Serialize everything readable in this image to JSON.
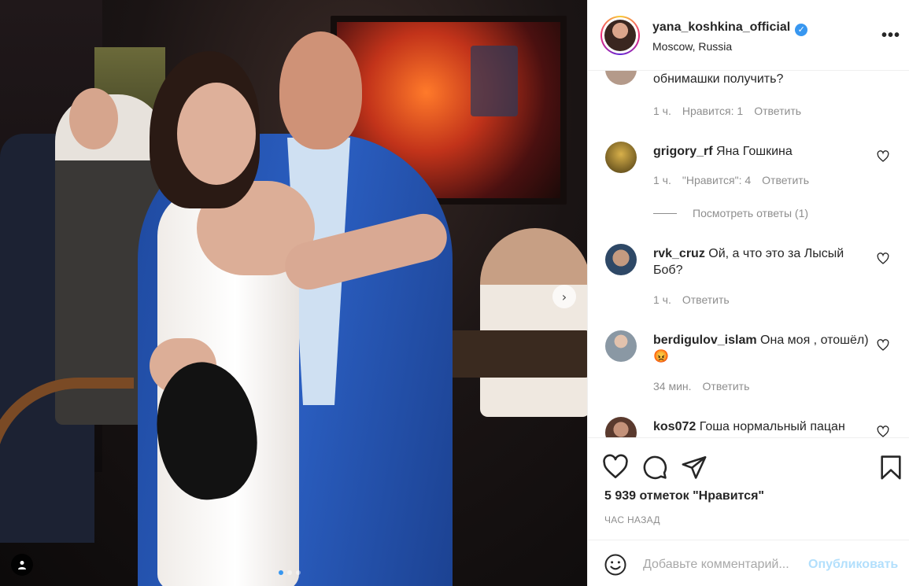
{
  "post": {
    "username": "yana_koshkina_official",
    "location": "Moscow, Russia",
    "verified_icon": "verified-badge-icon",
    "more_icon": "more-options-icon",
    "likes": "5 939 отметок \"Нравится\"",
    "time_ago": "ЧАС НАЗАД"
  },
  "carousel": {
    "next_icon": "chevron-right-icon",
    "dots": 3,
    "active_dot": 0
  },
  "comments": [
    {
      "username": "",
      "text": "обнимашки получить?",
      "time": "1 ч.",
      "likes": "Нравится: 1",
      "reply": "Ответить",
      "avatar_color": "#b49a8a"
    },
    {
      "username": "grigory_rf",
      "text": "Яна Гошкина",
      "time": "1 ч.",
      "likes": "\"Нравится\": 4",
      "reply": "Ответить",
      "avatar_color": "#6b5a2a",
      "view_replies": "Посмотреть ответы (1)"
    },
    {
      "username": "rvk_cruz",
      "text": "Ой, а что это за Лысый Боб?",
      "time": "1 ч.",
      "likes": "",
      "reply": "Ответить",
      "avatar_color": "#4a6a8a"
    },
    {
      "username": "berdigulov_islam",
      "text": "Она моя , отошёл)😡",
      "time": "34 мин.",
      "likes": "",
      "reply": "Ответить",
      "avatar_color": "#9aa7b0"
    },
    {
      "username": "kos072",
      "text": "Гоша нормальный пацан",
      "time": "",
      "likes": "",
      "reply": "",
      "avatar_color": "#7a5a4a"
    }
  ],
  "actions": {
    "like_icon": "heart-icon",
    "comment_icon": "comment-icon",
    "share_icon": "share-icon",
    "save_icon": "bookmark-icon"
  },
  "composer": {
    "emoji_icon": "emoji-icon",
    "placeholder": "Добавьте комментарий...",
    "submit_label": "Опубликовать"
  },
  "colors": {
    "accent": "#3897f0",
    "publish_disabled": "#b2dffc",
    "secondary_text": "#8e8e8e"
  }
}
